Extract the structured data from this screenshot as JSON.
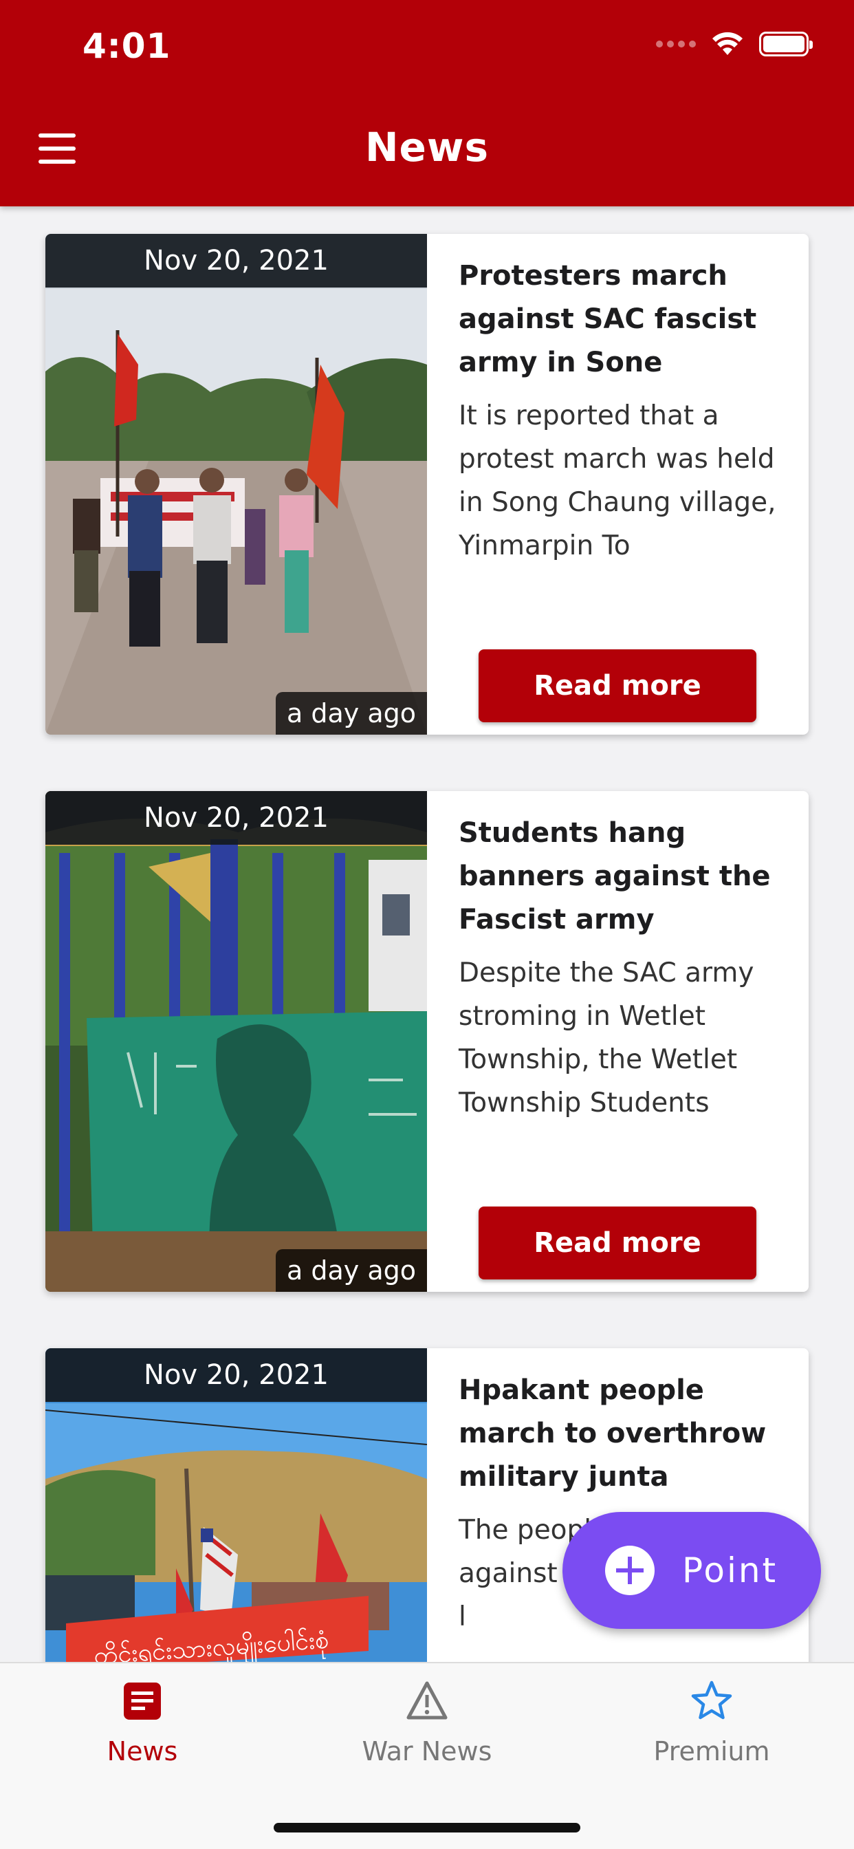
{
  "status_bar": {
    "time": "4:01"
  },
  "header": {
    "title": "News"
  },
  "articles": [
    {
      "date": "Nov 20, 2021",
      "ago": "a day ago",
      "title": "Protesters march against SAC fascist army in Sone",
      "excerpt": "It is reported that a protest march was held in Song Chaung village, Yinmarpin To",
      "button": "Read more"
    },
    {
      "date": "Nov 20, 2021",
      "ago": "a day ago",
      "title": "Students hang banners against the Fascist army",
      "excerpt": "Despite the SAC army stroming in Wetlet Township, the Wetlet Township Students",
      "button": "Read more"
    },
    {
      "date": "Nov 20, 2021",
      "title": "Hpakant people march to overthrow military junta",
      "excerpt": "The people staged a against the Fascist army l",
      "banner_text": "တိုင်းရင်းသားလူမျိုးပေါင်းစုံ"
    }
  ],
  "fab": {
    "label": "Point"
  },
  "tabs": [
    {
      "label": "News",
      "color": "#b30008"
    },
    {
      "label": "War News",
      "color": "#777777"
    },
    {
      "label": "Premium",
      "color": "#777777"
    }
  ]
}
